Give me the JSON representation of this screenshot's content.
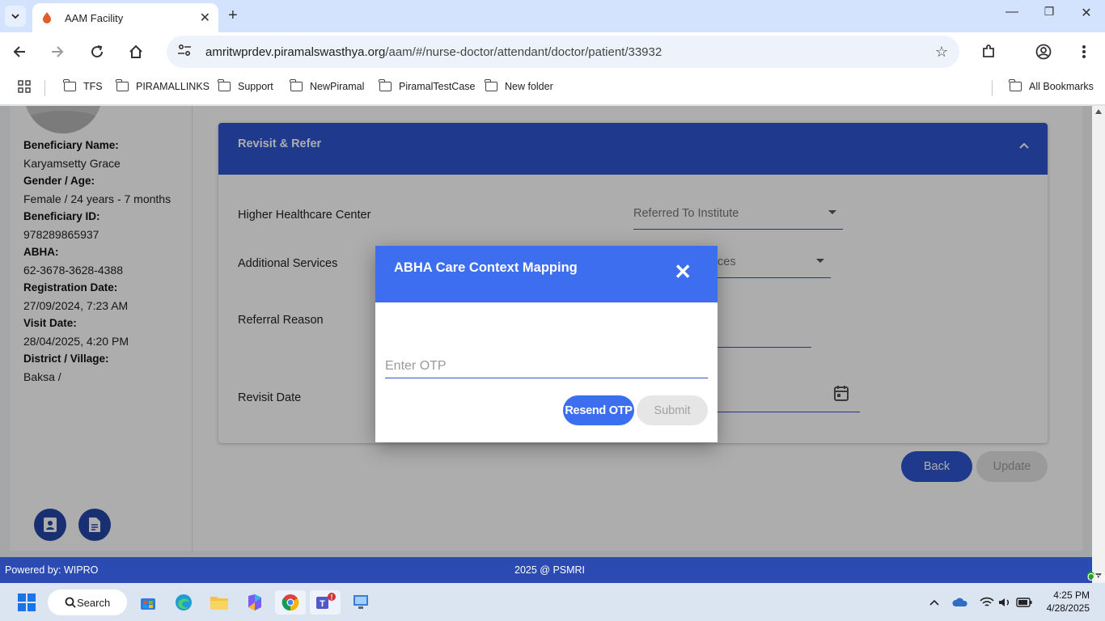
{
  "browser": {
    "tab_title": "AAM Facility",
    "url_host": "amritwprdev.piramalswasthya.org",
    "url_path": "/aam/#/nurse-doctor/attendant/doctor/patient/33932",
    "bookmarks": [
      "TFS",
      "PIRAMALLINKS",
      "Support",
      "NewPiramal",
      "PiramalTestCase",
      "New folder"
    ],
    "all_bookmarks": "All Bookmarks"
  },
  "beneficiary": {
    "fields": [
      {
        "label": "Beneficiary Name:",
        "value": "Karyamsetty Grace"
      },
      {
        "label": "Gender / Age:",
        "value": "Female / 24 years - 7 months"
      },
      {
        "label": "Beneficiary ID:",
        "value": "978289865937"
      },
      {
        "label": "ABHA:",
        "value": "62-3678-3628-4388"
      },
      {
        "label": "Registration Date:",
        "value": "27/09/2024, 7:23 AM"
      },
      {
        "label": "Visit Date:",
        "value": "28/04/2025, 4:20 PM"
      },
      {
        "label": "District / Village:",
        "value": "Baksa /"
      }
    ]
  },
  "revisit": {
    "title": "Revisit & Refer",
    "rows": {
      "higher_healthcare": "Higher Healthcare Center",
      "additional_services": "Additional Services",
      "referral_reason": "Referral Reason",
      "revisit_date": "Revisit Date"
    },
    "referred_to_placeholder": "Referred To Institute",
    "services_fragment": "ces",
    "back_label": "Back",
    "update_label": "Update"
  },
  "dialog": {
    "title": "ABHA Care Context Mapping",
    "otp_placeholder": "Enter OTP",
    "resend_label": "Resend OTP",
    "submit_label": "Submit"
  },
  "footer": {
    "powered": "Powered by: WIPRO",
    "copyright": "2025 @ PSMRI",
    "status": "Online"
  },
  "taskbar": {
    "search_label": "Search",
    "time": "4:25 PM",
    "date": "4/28/2025"
  },
  "colors": {
    "primary": "#2e54d0",
    "dialog_header": "#3d6ef0",
    "footer": "#2b4bb3",
    "online": "#1ca51c"
  }
}
